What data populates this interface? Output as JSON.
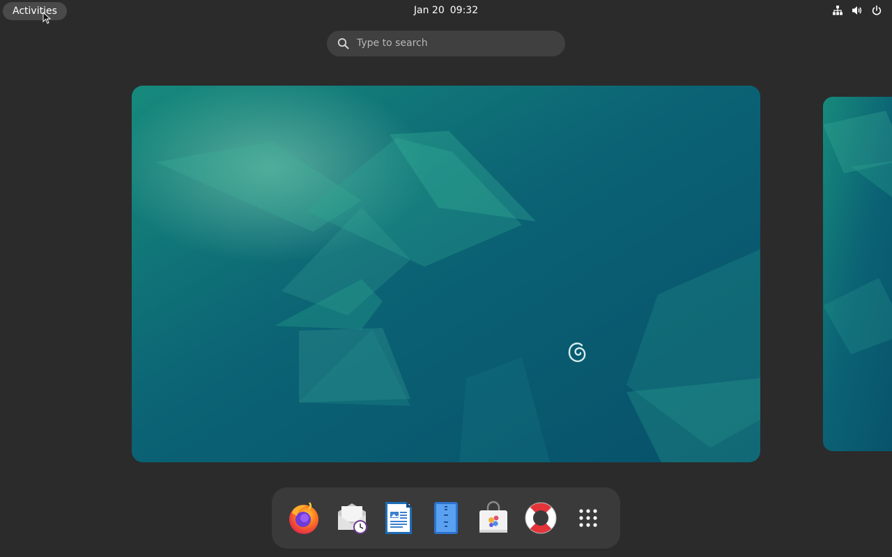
{
  "topbar": {
    "activities_label": "Activities",
    "date": "Jan 20",
    "time": "09:32",
    "tray_icons": [
      "network-icon",
      "volume-icon",
      "power-icon"
    ]
  },
  "search": {
    "placeholder": "Type to search"
  },
  "overview": {
    "workspace_count": 2,
    "active_workspace": 1,
    "wallpaper": "debian-emerald"
  },
  "dash": {
    "apps": [
      {
        "name": "Firefox",
        "icon": "firefox-icon"
      },
      {
        "name": "Evolution",
        "icon": "mail-clock-icon"
      },
      {
        "name": "LibreOffice Writer",
        "icon": "writer-document-icon"
      },
      {
        "name": "Text Editor",
        "icon": "text-editor-icon"
      },
      {
        "name": "Software",
        "icon": "software-bag-icon"
      },
      {
        "name": "Help",
        "icon": "lifebuoy-icon"
      },
      {
        "name": "Show Applications",
        "icon": "app-grid-icon"
      }
    ]
  },
  "colors": {
    "panel_bg": "#2b2b2b",
    "dash_bg": "#3a3a3a",
    "search_bg": "#404040",
    "wallpaper_base": "#08516c",
    "wallpaper_accent": "#1a8f7a"
  }
}
